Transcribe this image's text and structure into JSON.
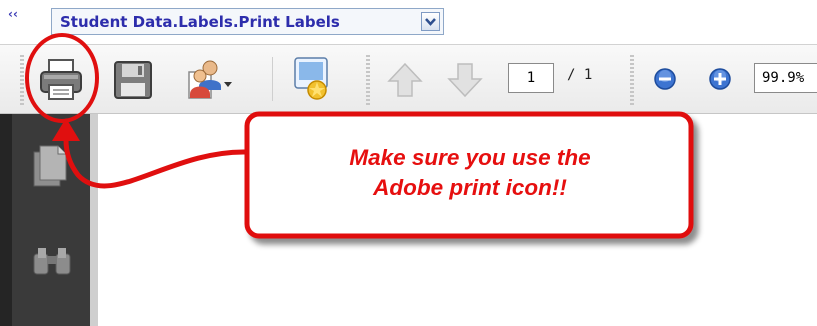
{
  "report_bar": {
    "collapse_glyph": "‹‹",
    "report_name": "Student Data.Labels.Print Labels",
    "dropdown_icon": "chevron-down-icon"
  },
  "toolbar": {
    "buttons": [
      "print-icon",
      "save-icon",
      "share-icon",
      "collaborate-icon",
      "previous-page-icon",
      "next-page-icon",
      "zoom-out-icon",
      "zoom-in-icon"
    ],
    "page_number": "1",
    "page_total": "/ 1",
    "zoom": "99.9%"
  },
  "navigation": {
    "icons": [
      "pages-icon",
      "search-binoculars-icon"
    ]
  },
  "annotation": {
    "line1": "Make sure you use the",
    "line2": "Adobe print icon!!",
    "color": "#e60f0f"
  }
}
